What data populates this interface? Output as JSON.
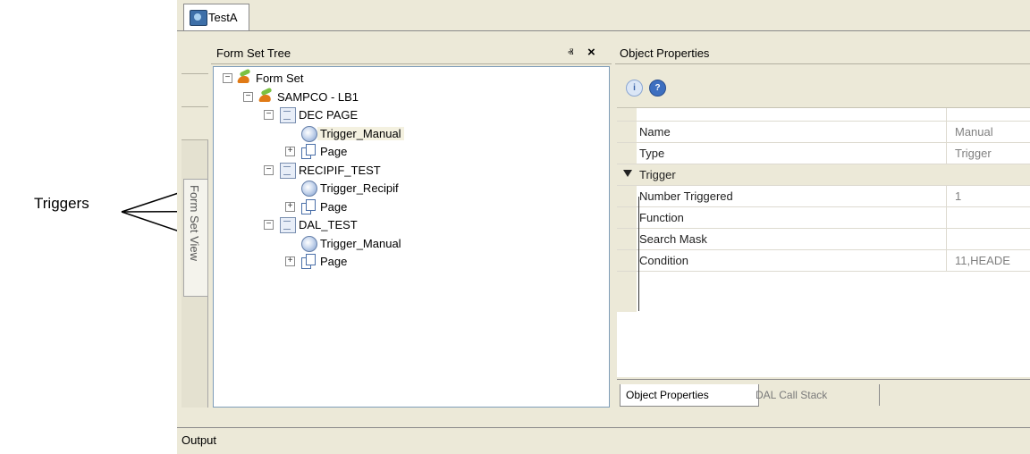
{
  "annotation": {
    "label": "Triggers"
  },
  "document_tab": {
    "label": "TestA"
  },
  "form_set_tree": {
    "title": "Form Set Tree",
    "pin_glyph": "ⱏ",
    "close_glyph": "×",
    "side_tab": "Form Set View",
    "nodes": [
      {
        "label": "Form Set",
        "icon": "form-set-icon",
        "expander": "−"
      },
      {
        "label": "SAMPCO - LB1",
        "icon": "form-set-icon",
        "expander": "−"
      },
      {
        "label": "DEC PAGE",
        "icon": "form-icon",
        "expander": "−"
      },
      {
        "label": "Trigger_Manual",
        "icon": "trigger-icon",
        "selected": true
      },
      {
        "label": "Page",
        "icon": "page-icon",
        "expander": "+"
      },
      {
        "label": "RECIPIF_TEST",
        "icon": "form-icon",
        "expander": "−"
      },
      {
        "label": "Trigger_Recipif",
        "icon": "trigger-icon"
      },
      {
        "label": "Page",
        "icon": "page-icon",
        "expander": "+"
      },
      {
        "label": "DAL_TEST",
        "icon": "form-icon",
        "expander": "−"
      },
      {
        "label": "Trigger_Manual",
        "icon": "trigger-icon"
      },
      {
        "label": "Page",
        "icon": "page-icon",
        "expander": "+"
      }
    ]
  },
  "object_properties": {
    "title": "Object Properties",
    "toolbar": {
      "info_glyph": "i",
      "help_glyph": "?"
    },
    "rows": [
      {
        "name": "Name",
        "value": "Manual"
      },
      {
        "name": "Type",
        "value": "Trigger"
      },
      {
        "category": "Trigger"
      },
      {
        "name": "Number Triggered",
        "value": "1"
      },
      {
        "name": "Function",
        "value": ""
      },
      {
        "name": "Search Mask",
        "value": ""
      },
      {
        "name": "Condition",
        "value": "11,HEADE"
      }
    ],
    "tabs": {
      "active": "Object Properties",
      "inactive": "DAL Call Stack"
    }
  },
  "output": {
    "label": "Output"
  }
}
